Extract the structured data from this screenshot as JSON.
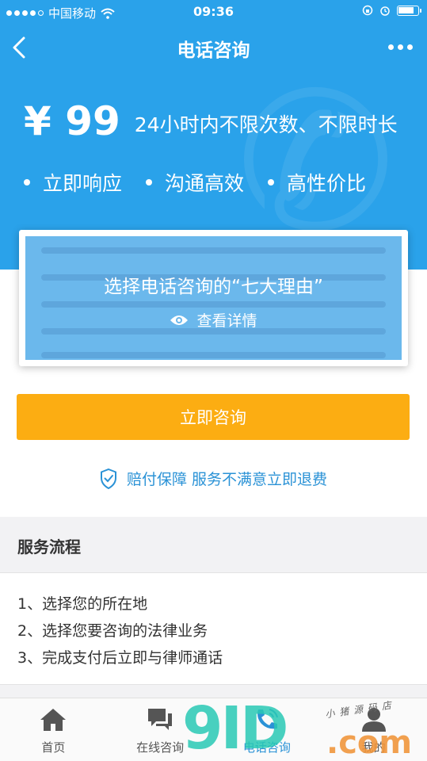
{
  "status_bar": {
    "carrier": "中国移动",
    "time": "09:36",
    "battery_level": 0.85
  },
  "navbar": {
    "title": "电话咨询"
  },
  "hero": {
    "price": "¥ 99",
    "price_desc": "24小时内不限次数、不限时长",
    "features": [
      "立即响应",
      "沟通高效",
      "高性价比"
    ]
  },
  "reasons_card": {
    "title": "选择电话咨询的“七大理由”",
    "link_label": "查看详情"
  },
  "consult_button": {
    "label": "立即咨询"
  },
  "guarantee": {
    "text": "赔付保障 服务不满意立即退费"
  },
  "process": {
    "heading": "服务流程",
    "steps": [
      "1、选择您的所在地",
      "2、选择您要咨询的法律业务",
      "3、完成支付后立即与律师通话"
    ]
  },
  "tabbar": {
    "tabs": [
      {
        "label": "首页",
        "icon": "home-icon"
      },
      {
        "label": "在线咨询",
        "icon": "chat-icon"
      },
      {
        "label": "电话咨询",
        "icon": "phone-icon"
      },
      {
        "label": "我的",
        "icon": "user-icon"
      }
    ]
  },
  "watermark": {
    "brand": "9ID",
    "suffix": ".com",
    "small_text": "小猪源码店"
  },
  "colors": {
    "primary_blue": "#2aa2ea",
    "accent_orange": "#fcad12",
    "link_blue": "#2a92d6"
  }
}
